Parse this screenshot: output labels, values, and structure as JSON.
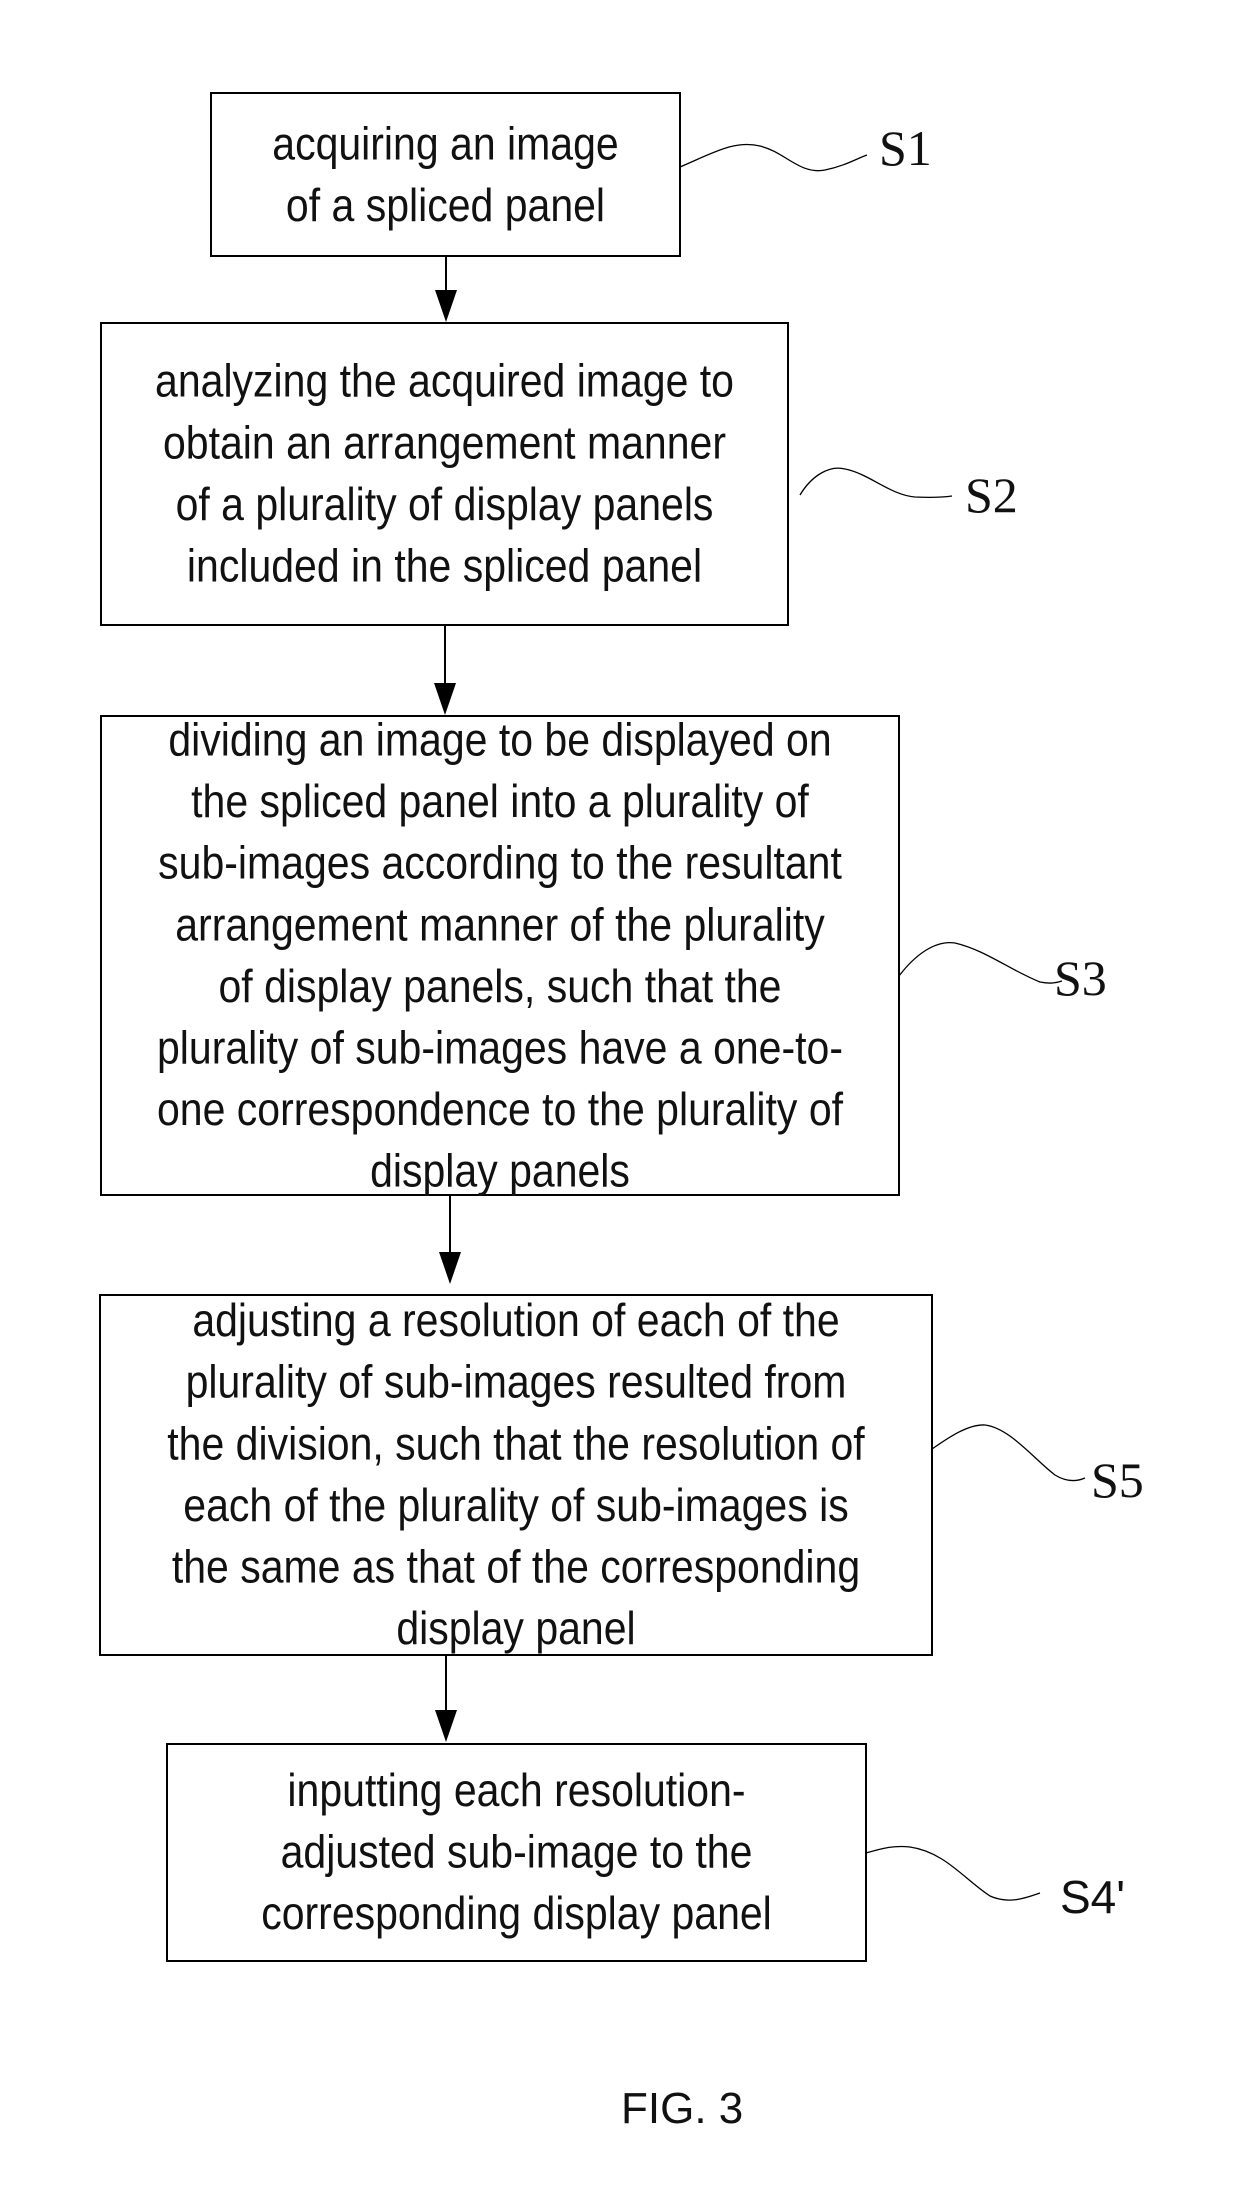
{
  "figure": {
    "caption": "FIG. 3",
    "line_color": "#000000"
  },
  "steps": [
    {
      "id": "S1",
      "label": "S1",
      "text": "acquiring an image\nof a spliced panel"
    },
    {
      "id": "S2",
      "label": "S2",
      "text": "analyzing the acquired image to\nobtain an arrangement manner\nof a plurality of display panels\nincluded in the spliced panel"
    },
    {
      "id": "S3",
      "label": "S3",
      "text": "dividing an image to be displayed on\nthe spliced panel into a plurality of\nsub-images according to the resultant\narrangement manner of the plurality\nof display panels, such that the\nplurality of sub-images have a one-to-\none correspondence to the plurality of\ndisplay panels"
    },
    {
      "id": "S5",
      "label": "S5",
      "text": "adjusting a resolution of each of the\nplurality of sub-images resulted from\nthe division, such that the resolution of\neach of the plurality of sub-images is\nthe same as that of the corresponding\ndisplay panel"
    },
    {
      "id": "S4prime",
      "label": "S4'",
      "text": "inputting each resolution-\nadjusted sub-image to the\ncorresponding display panel"
    }
  ],
  "flow": [
    {
      "from": "S1",
      "to": "S2"
    },
    {
      "from": "S2",
      "to": "S3"
    },
    {
      "from": "S3",
      "to": "S5"
    },
    {
      "from": "S5",
      "to": "S4prime"
    }
  ]
}
